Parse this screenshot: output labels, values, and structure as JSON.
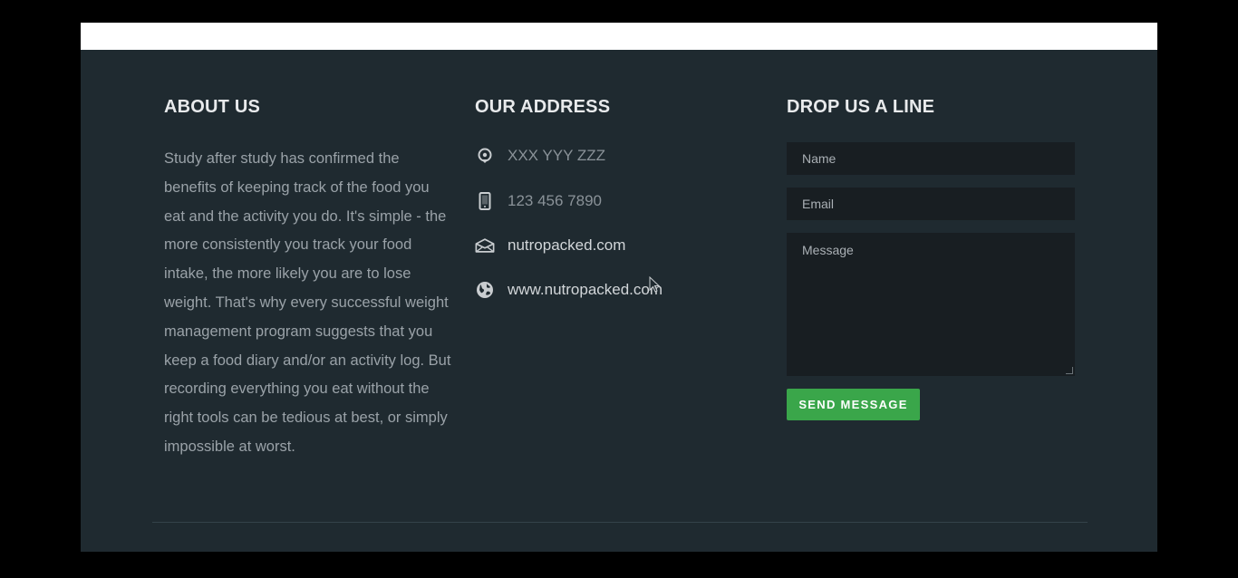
{
  "about": {
    "title": "ABOUT US",
    "text": "Study after study has confirmed the benefits of keeping track of the food you eat and the activity you do. It's simple - the more consistently you track your food intake, the more likely you are to lose weight. That's why every successful weight management program suggests that you keep a food diary and/or an activity log. But recording everything you eat without the right tools can be tedious at best, or simply impossible at worst."
  },
  "address": {
    "title": "OUR ADDRESS",
    "items": [
      {
        "icon": "location-pin-icon",
        "text": "XXX YYY ZZZ"
      },
      {
        "icon": "phone-icon",
        "text": "123 456 7890"
      },
      {
        "icon": "envelope-icon",
        "text": "nutropacked.com"
      },
      {
        "icon": "globe-icon",
        "text": "www.nutropacked.com"
      }
    ]
  },
  "contact": {
    "title": "DROP US A LINE",
    "name_placeholder": "Name",
    "email_placeholder": "Email",
    "message_placeholder": "Message",
    "send_label": "SEND MESSAGE"
  },
  "colors": {
    "background": "#1f2a30",
    "accent": "#3aa64a",
    "field": "#181e22"
  }
}
